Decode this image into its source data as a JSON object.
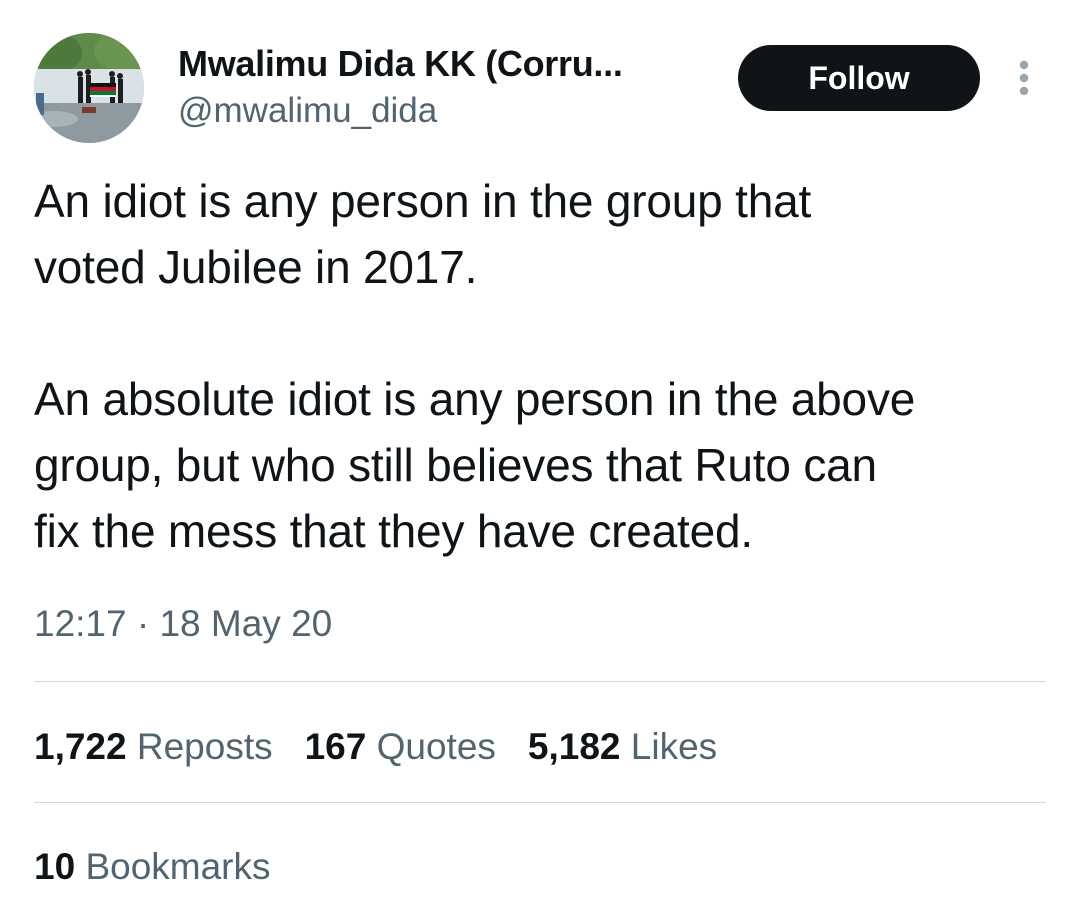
{
  "author": {
    "display_name": "Mwalimu Dida KK (Corru...",
    "handle": "@mwalimu_dida",
    "avatar_icon": "protest-crowd-with-flag-avatar"
  },
  "header": {
    "follow_label": "Follow",
    "more_icon": "vertical-ellipsis-icon"
  },
  "tweet": {
    "text": "An idiot is any person in the group that\nvoted Jubilee in 2017.\n\nAn absolute idiot is any person in the above\ngroup, but who still believes that Ruto can\nfix the mess that they have created.",
    "timestamp": "12:17 · 18 May 20"
  },
  "stats": {
    "reposts_count": "1,722",
    "reposts_label": "Reposts",
    "quotes_count": "167",
    "quotes_label": "Quotes",
    "likes_count": "5,182",
    "likes_label": "Likes",
    "bookmarks_count": "10",
    "bookmarks_label": "Bookmarks"
  },
  "colors": {
    "text_primary": "#0f1419",
    "text_secondary": "#536471",
    "divider": "#cfd9de",
    "follow_bg": "#0f1419"
  }
}
